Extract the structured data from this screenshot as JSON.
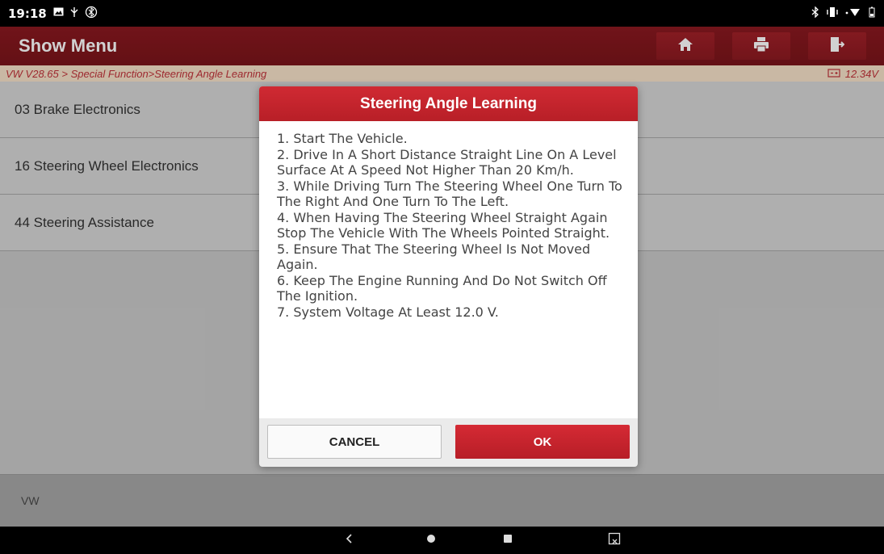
{
  "status_bar": {
    "time": "19:18",
    "left_icons": [
      "image-icon",
      "usb-debug-icon",
      "bluetooth-off-icon"
    ],
    "right_icons": [
      "bluetooth-icon",
      "vibrate-icon",
      "wifi-icon",
      "battery-icon"
    ]
  },
  "app_bar": {
    "title": "Show Menu",
    "buttons": [
      "home-icon",
      "print-icon",
      "exit-icon"
    ]
  },
  "breadcrumb": {
    "path": "VW V28.65 > Special Function>Steering Angle Learning",
    "voltage": "12.34V"
  },
  "list": {
    "items": [
      {
        "label": "03 Brake Electronics"
      },
      {
        "label": "16 Steering Wheel Electronics"
      },
      {
        "label": "44 Steering Assistance"
      }
    ]
  },
  "footer": {
    "label": "VW"
  },
  "dialog": {
    "title": "Steering Angle Learning",
    "lines": [
      "1. Start The Vehicle.",
      "2. Drive In A Short Distance Straight Line On A Level Surface At A Speed Not Higher Than 20 Km/h.",
      "3. While Driving Turn The Steering Wheel One Turn To The Right And One Turn To The Left.",
      "4. When Having The Steering Wheel Straight Again Stop The Vehicle With The Wheels Pointed Straight.",
      "5. Ensure That The Steering Wheel Is Not Moved Again.",
      "6. Keep The Engine Running And Do Not Switch Off The Ignition.",
      "7. System Voltage At Least 12.0 V."
    ],
    "cancel_label": "CANCEL",
    "ok_label": "OK"
  },
  "colors": {
    "brand_red": "#b81f27",
    "appbar_red": "#7a141a"
  }
}
